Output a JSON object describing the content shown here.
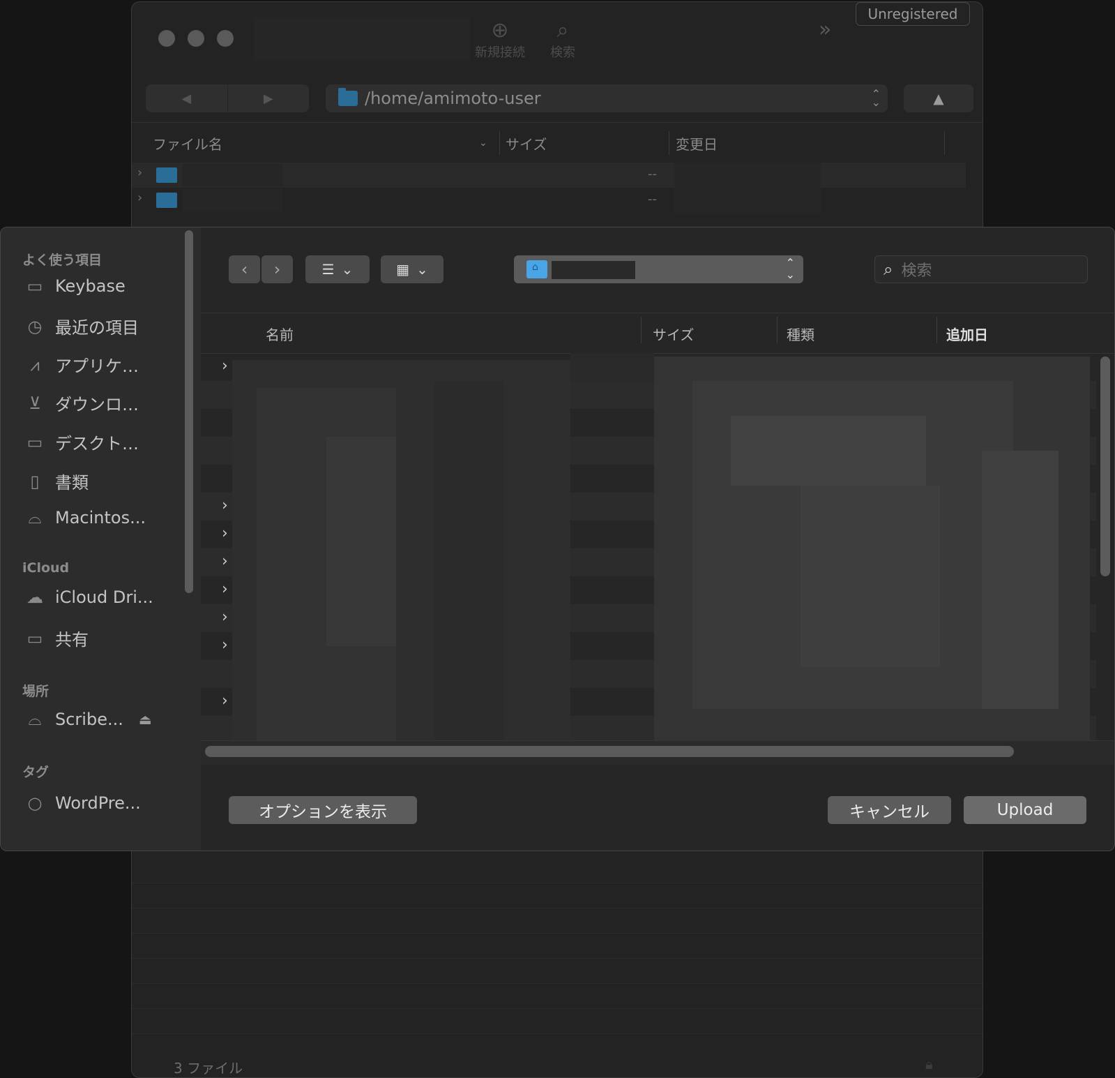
{
  "background_window": {
    "toolbar": {
      "new_connection_label": "新規接続",
      "search_label": "検索",
      "unregistered_label": "Unregistered"
    },
    "nav": {
      "back": "◀",
      "forward": "▶",
      "up": "▲"
    },
    "path": "/home/amimoto-user",
    "columns": {
      "filename": "ファイル名",
      "size": "サイズ",
      "modified": "変更日"
    },
    "rows": [
      {
        "size": "--"
      },
      {
        "size": "--"
      }
    ],
    "status": "3 ファイル"
  },
  "dialog": {
    "sidebar": {
      "favorites_heading": "よく使う項目",
      "favorites": [
        {
          "label": "Keybase",
          "icon": "folder-icon"
        },
        {
          "label": "最近の項目",
          "icon": "clock-icon"
        },
        {
          "label": "アプリケ…",
          "icon": "apps-icon"
        },
        {
          "label": "ダウンロ…",
          "icon": "download-icon"
        },
        {
          "label": "デスクト…",
          "icon": "desktop-icon"
        },
        {
          "label": "書類",
          "icon": "document-icon"
        },
        {
          "label": "Macintos...",
          "icon": "disk-icon"
        }
      ],
      "icloud_heading": "iCloud",
      "icloud": [
        {
          "label": "iCloud Dri...",
          "icon": "cloud-icon"
        },
        {
          "label": "共有",
          "icon": "shared-folder-icon"
        }
      ],
      "locations_heading": "場所",
      "locations": [
        {
          "label": "Scribe...",
          "icon": "disk-icon"
        }
      ],
      "tags_heading": "タグ",
      "tags": [
        {
          "label": "WordPre...",
          "icon": "tag-circle-icon"
        }
      ]
    },
    "toolbar": {
      "search_placeholder": "検索"
    },
    "columns": {
      "name": "名前",
      "size": "サイズ",
      "kind": "種類",
      "date_added": "追加日"
    },
    "buttons": {
      "options": "オプションを表示",
      "cancel": "キャンセル",
      "upload": "Upload"
    }
  },
  "colors": {
    "accent_folder": "#4aa5e6",
    "dark_folder": "#2a6e98",
    "dialog_bg": "#262626",
    "sidebar_bg": "#2c2c2c"
  }
}
